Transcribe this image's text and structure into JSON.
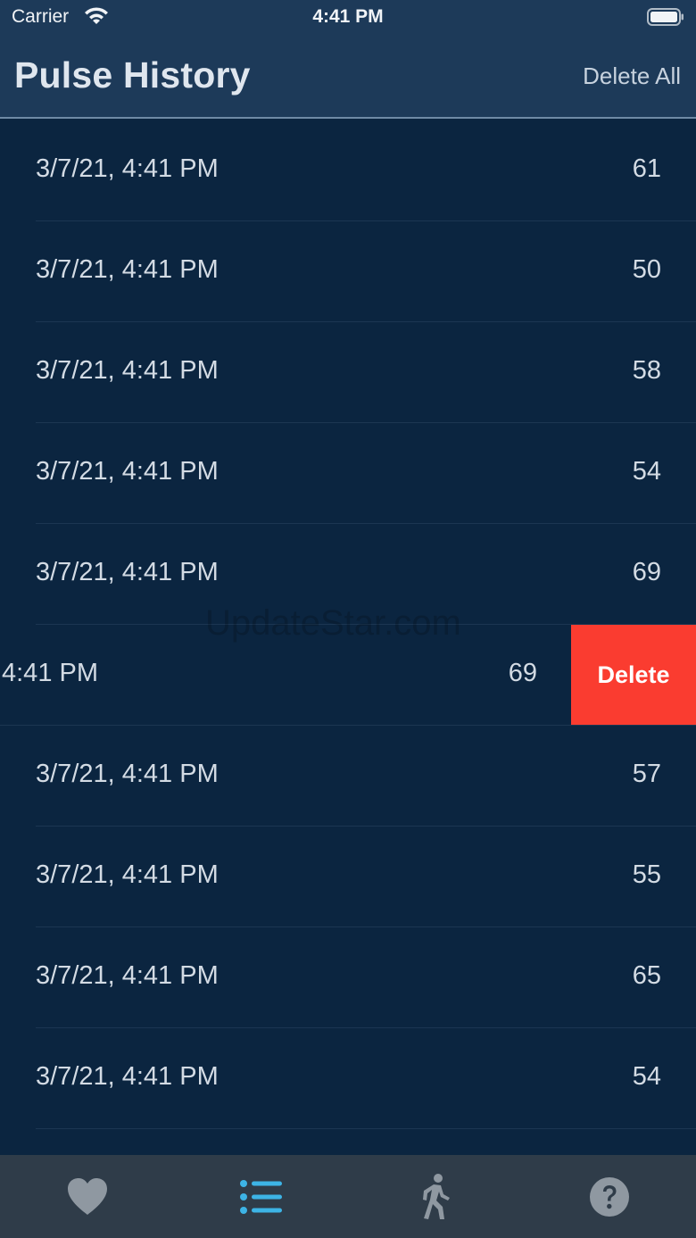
{
  "status": {
    "carrier": "Carrier",
    "time": "4:41 PM"
  },
  "header": {
    "title": "Pulse History",
    "delete_all": "Delete All"
  },
  "rows": [
    {
      "date": "3/7/21, 4:41 PM",
      "value": "61"
    },
    {
      "date": "3/7/21, 4:41 PM",
      "value": "50"
    },
    {
      "date": "3/7/21, 4:41 PM",
      "value": "58"
    },
    {
      "date": "3/7/21, 4:41 PM",
      "value": "54"
    },
    {
      "date": "3/7/21, 4:41 PM",
      "value": "69"
    },
    {
      "date": "4:41 PM",
      "value": "69",
      "swiped": true,
      "action": "Delete"
    },
    {
      "date": "3/7/21, 4:41 PM",
      "value": "57"
    },
    {
      "date": "3/7/21, 4:41 PM",
      "value": "55"
    },
    {
      "date": "3/7/21, 4:41 PM",
      "value": "65"
    },
    {
      "date": "3/7/21, 4:41 PM",
      "value": "54"
    }
  ],
  "watermark": "UpdateStar.com",
  "tabs": [
    {
      "icon": "heart-icon",
      "active": false
    },
    {
      "icon": "list-icon",
      "active": true
    },
    {
      "icon": "walking-icon",
      "active": false
    },
    {
      "icon": "help-icon",
      "active": false
    }
  ],
  "colors": {
    "header_bg": "#1d3a59",
    "list_bg": "#0b2540",
    "delete_red": "#fa3c30",
    "tab_active": "#3db4e6",
    "tab_inactive": "#8f98a1"
  }
}
